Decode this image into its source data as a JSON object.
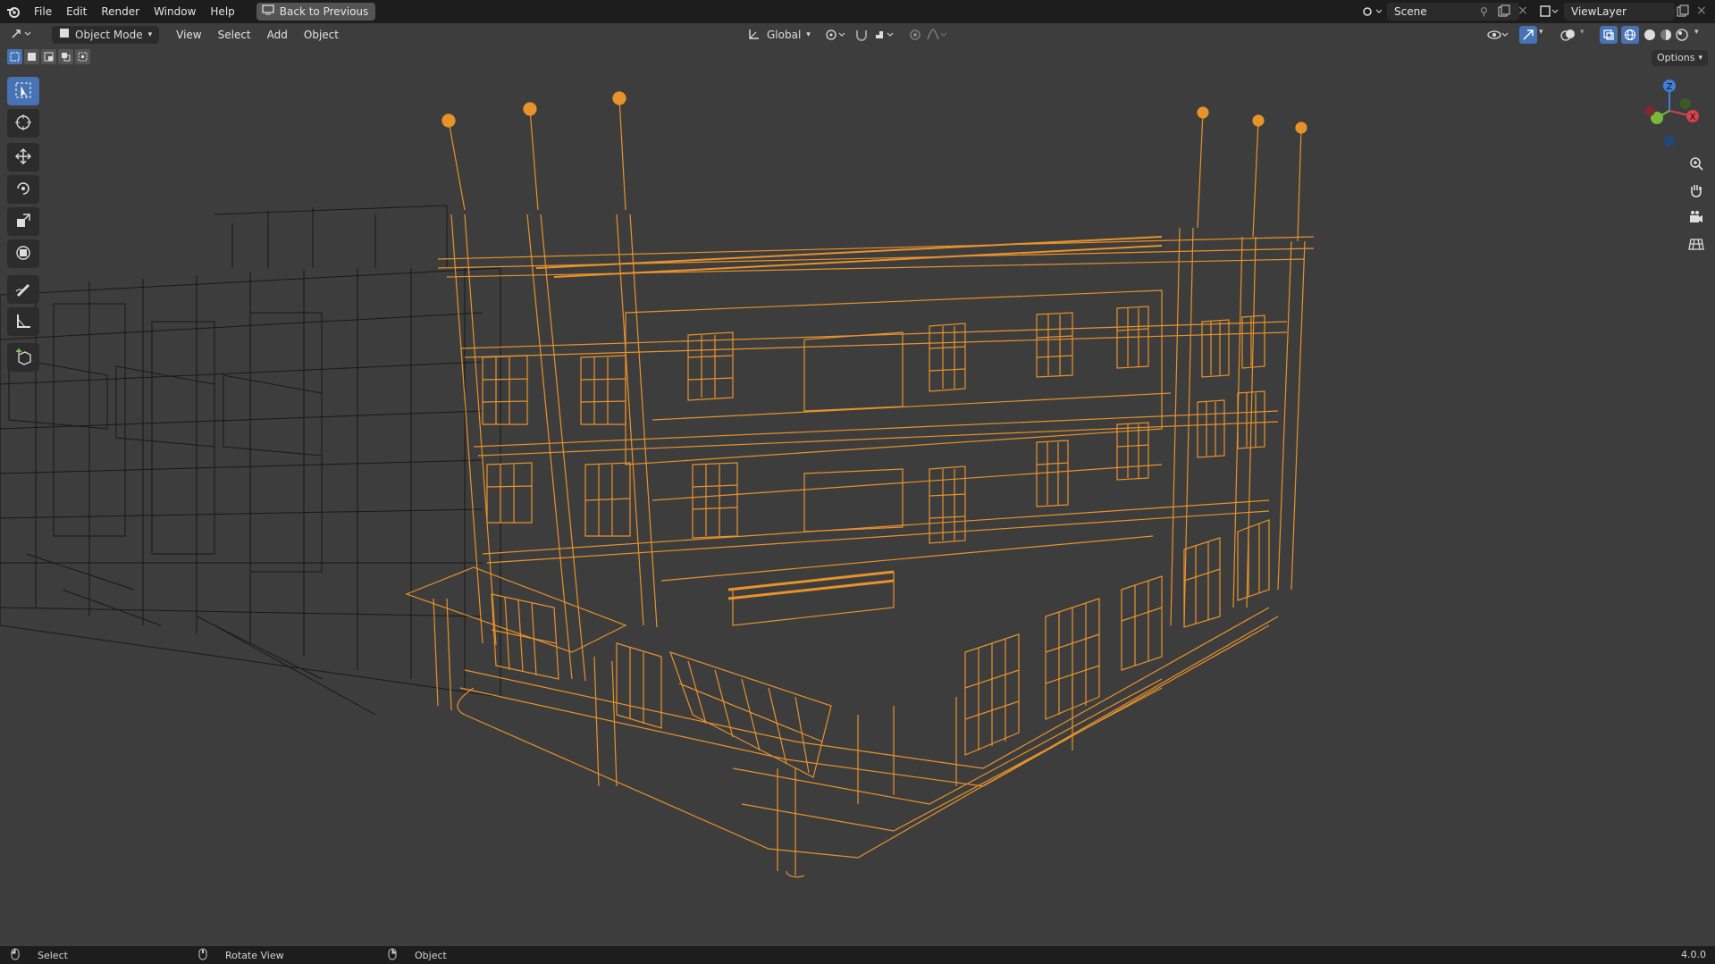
{
  "menubar": {
    "items": [
      "File",
      "Edit",
      "Render",
      "Window",
      "Help"
    ],
    "back_button": "Back to Previous",
    "scene": "Scene",
    "view_layer": "ViewLayer"
  },
  "header": {
    "mode": "Object Mode",
    "menus": [
      "View",
      "Select",
      "Add",
      "Object"
    ],
    "orientation": "Global",
    "options": "Options"
  },
  "toolbar": {
    "tools": [
      "select-box-icon",
      "cursor-icon",
      "move-icon",
      "rotate-icon",
      "scale-icon",
      "transform-icon",
      "annotate-icon",
      "measure-icon",
      "add-cube-icon"
    ]
  },
  "gizmo": {
    "z": "Z",
    "x": "X",
    "y": "Y"
  },
  "statusbar": {
    "select": "Select",
    "rotate_view": "Rotate View",
    "object": "Object",
    "version": "4.0.0"
  },
  "colors": {
    "selection": "#e8922a",
    "background": "#3d3d3d",
    "wire_dim": "#1a1a1a",
    "active_tool": "#4772b3"
  }
}
